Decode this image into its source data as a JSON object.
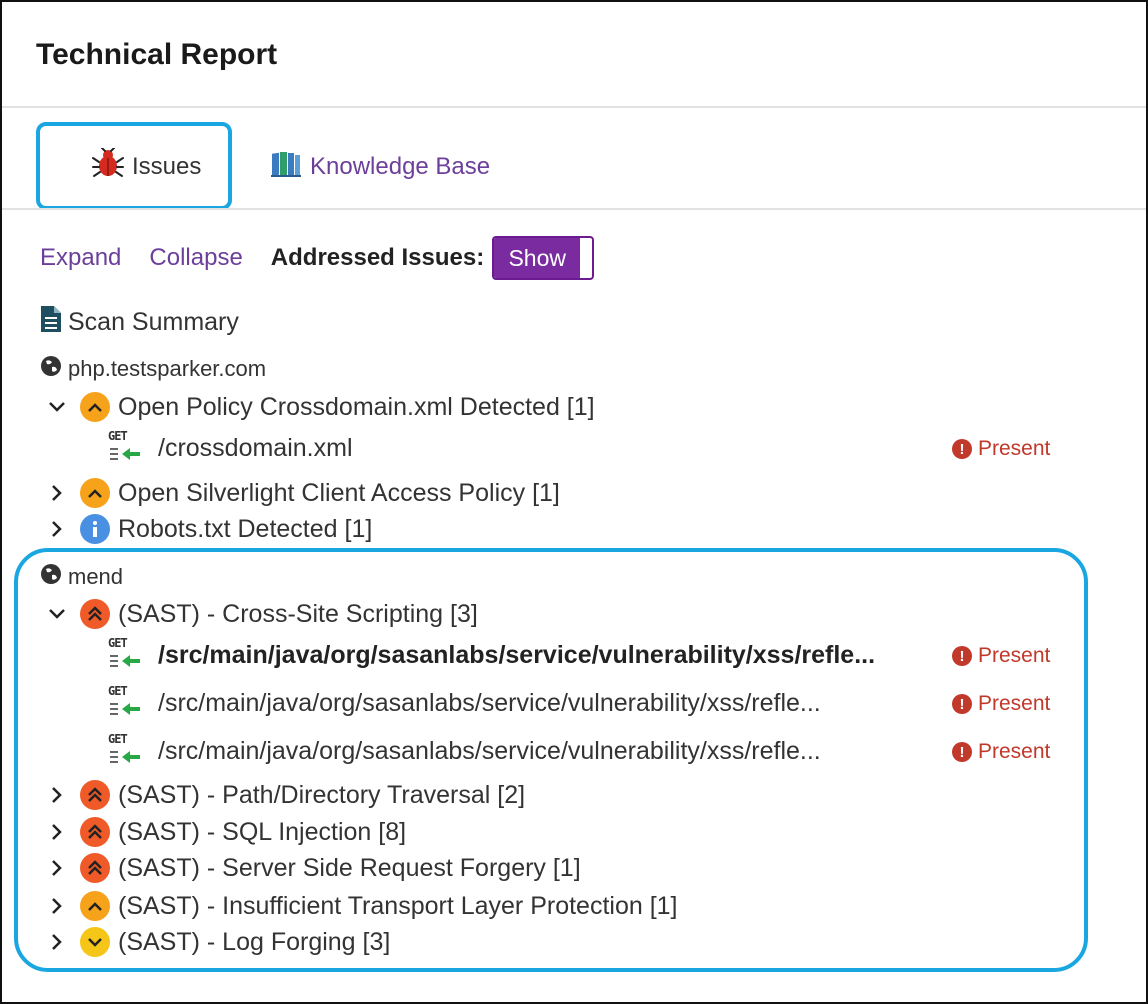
{
  "page": {
    "title": "Technical Report"
  },
  "tabs": [
    {
      "label": "Issues",
      "icon": "bug-icon",
      "active": true
    },
    {
      "label": "Knowledge Base",
      "icon": "books-icon"
    }
  ],
  "toolbar": {
    "expand_label": "Expand",
    "collapse_label": "Collapse",
    "addressed_label": "Addressed Issues:",
    "toggle_label": "Show"
  },
  "scan_summary": {
    "label": "Scan Summary",
    "icon": "document-icon"
  },
  "hosts": [
    {
      "name": "php.testsparker.com",
      "icon": "globe-icon",
      "issues": [
        {
          "label": "Open Policy Crossdomain.xml Detected [1]",
          "severity": "medium",
          "expanded": true,
          "requests": [
            {
              "method": "GET",
              "path": "/crossdomain.xml",
              "status": "Present"
            }
          ]
        },
        {
          "label": "Open Silverlight Client Access Policy [1]",
          "severity": "medium",
          "expanded": false
        },
        {
          "label": "Robots.txt Detected [1]",
          "severity": "info",
          "expanded": false
        }
      ]
    },
    {
      "name": "mend",
      "icon": "globe-icon",
      "issues": [
        {
          "label": "(SAST) - Cross-Site Scripting [3]",
          "severity": "high",
          "expanded": true,
          "requests": [
            {
              "method": "GET",
              "path": "/src/main/java/org/sasanlabs/service/vulnerability/xss/refle...",
              "status": "Present",
              "selected": true
            },
            {
              "method": "GET",
              "path": "/src/main/java/org/sasanlabs/service/vulnerability/xss/refle...",
              "status": "Present"
            },
            {
              "method": "GET",
              "path": "/src/main/java/org/sasanlabs/service/vulnerability/xss/refle...",
              "status": "Present"
            }
          ]
        },
        {
          "label": "(SAST) - Path/Directory Traversal [2]",
          "severity": "high",
          "expanded": false
        },
        {
          "label": "(SAST) - SQL Injection [8]",
          "severity": "high",
          "expanded": false
        },
        {
          "label": "(SAST) - Server Side Request Forgery [1]",
          "severity": "high",
          "expanded": false
        },
        {
          "label": "(SAST) - Insufficient Transport Layer Protection [1]",
          "severity": "medium",
          "expanded": false
        },
        {
          "label": "(SAST) - Log Forging [3]",
          "severity": "low",
          "expanded": false
        }
      ]
    }
  ],
  "colors": {
    "accent": "#6b3f9a",
    "toggle_bg": "#7b2ba0",
    "highlight": "#1aa6e0",
    "present": "#c0392b",
    "severity_high": "#f05a28",
    "severity_medium": "#f7a21b",
    "severity_low": "#f5c518",
    "severity_info": "#4a90e2"
  }
}
